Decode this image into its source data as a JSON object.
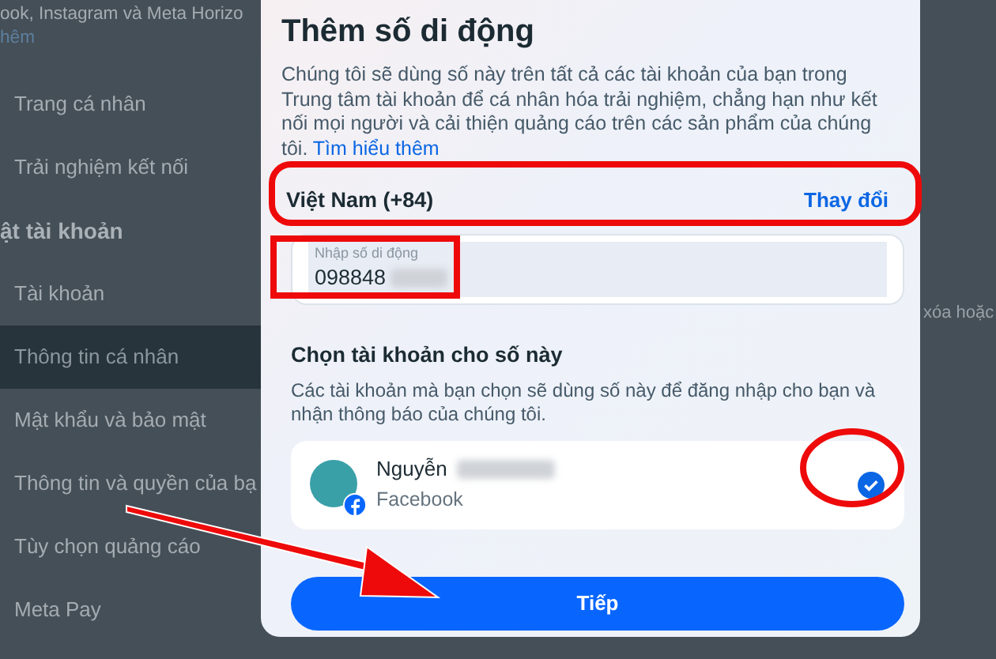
{
  "background": {
    "intro_lines": [
      "ook, Instagram và Meta Horizo",
      "hêm"
    ],
    "sidebar": [
      {
        "kind": "item",
        "label": "Trang cá nhân",
        "selected": false
      },
      {
        "kind": "item",
        "label": "Trải nghiệm kết nối",
        "selected": false
      },
      {
        "kind": "heading",
        "label": "ật tài khoản"
      },
      {
        "kind": "item",
        "label": "Tài khoản",
        "selected": false
      },
      {
        "kind": "item",
        "label": "Thông tin cá nhân",
        "selected": true
      },
      {
        "kind": "item",
        "label": "Mật khẩu và bảo mật",
        "selected": false
      },
      {
        "kind": "item",
        "label": "Thông tin và quyền của bạ",
        "selected": false
      },
      {
        "kind": "item",
        "label": "Tùy chọn quảng cáo",
        "selected": false
      },
      {
        "kind": "item",
        "label": "Meta Pay",
        "selected": false
      }
    ],
    "right_text": "xóa hoặc"
  },
  "dialog": {
    "title": "Thêm số di động",
    "description": "Chúng tôi sẽ dùng số này trên tất cả các tài khoản của bạn trong Trung tâm tài khoản để cá nhân hóa trải nghiệm, chẳng hạn như kết nối mọi người và cải thiện quảng cáo trên các sản phẩm của chúng tôi.",
    "learn_more": "Tìm hiểu thêm",
    "country": "Việt Nam (+84)",
    "change_link": "Thay đổi",
    "phone_field": {
      "placeholder": "Nhập số di động",
      "value": "098848"
    },
    "accounts_heading": "Chọn tài khoản cho số này",
    "accounts_description": "Các tài khoản mà bạn chọn sẽ dùng số này để đăng nhập cho bạn và nhận thông báo của chúng tôi.",
    "accounts": [
      {
        "name": "Nguyễn",
        "platform": "Facebook",
        "checked": true
      }
    ],
    "next_button": "Tiếp"
  }
}
